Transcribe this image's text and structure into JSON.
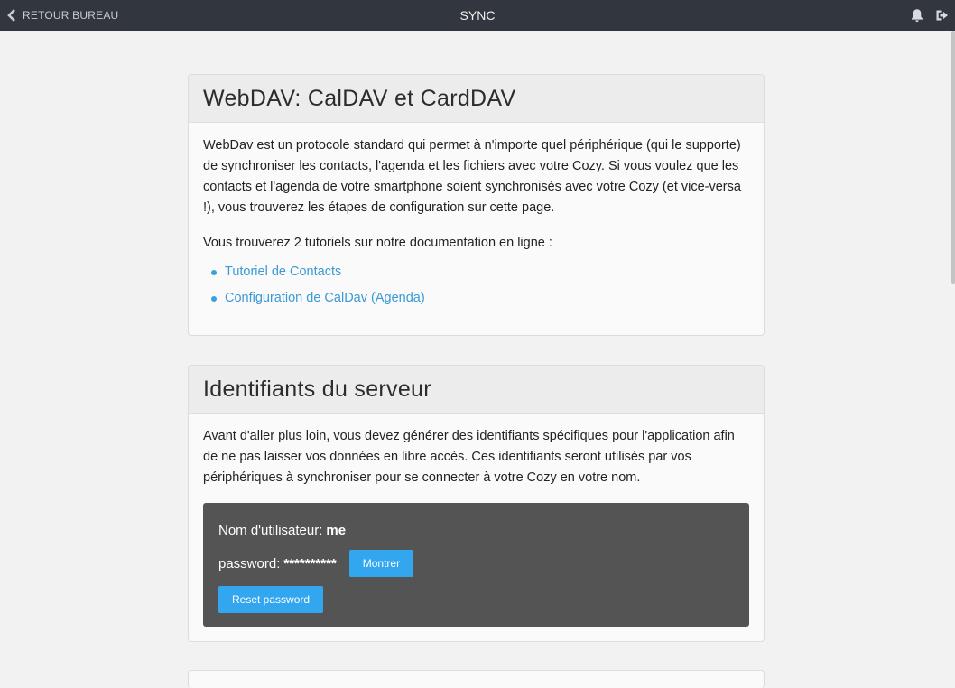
{
  "topbar": {
    "back_label": "RETOUR BUREAU",
    "title": "SYNC",
    "icons": [
      "bell-icon",
      "logout-icon"
    ]
  },
  "webdav": {
    "title": "WebDAV: CalDAV et CardDAV",
    "intro": "WebDav est un protocole standard qui permet à n'importe quel périphérique (qui le supporte) de synchroniser les contacts, l'agenda et les fichiers avec votre Cozy. Si vous voulez que les contacts et l'agenda de votre smartphone soient synchronisés avec votre Cozy (et vice-versa !), vous trouverez les étapes de configuration sur cette page.",
    "tutorials_intro": "Vous trouverez 2 tutoriels sur notre documentation en ligne :",
    "links": [
      {
        "label": "Tutoriel de Contacts"
      },
      {
        "label": "Configuration de CalDav (Agenda)"
      }
    ]
  },
  "credentials": {
    "title": "Identifiants du serveur",
    "intro": "Avant d'aller plus loin, vous devez générer des identifiants spécifiques pour l'application afin de ne pas laisser vos données en libre accès. Ces identifiants seront utilisés par vos périphériques à synchroniser pour se connecter à votre Cozy en votre nom.",
    "username_label": "Nom d'utilisateur:",
    "username_value": "me",
    "password_label": "password:",
    "password_value": "**********",
    "show_button": "Montrer",
    "reset_button": "Reset password"
  },
  "colors": {
    "topbar": "#32363f",
    "accent": "#33a6f0",
    "link": "#3a9ad6",
    "credentials_box": "#545454"
  }
}
